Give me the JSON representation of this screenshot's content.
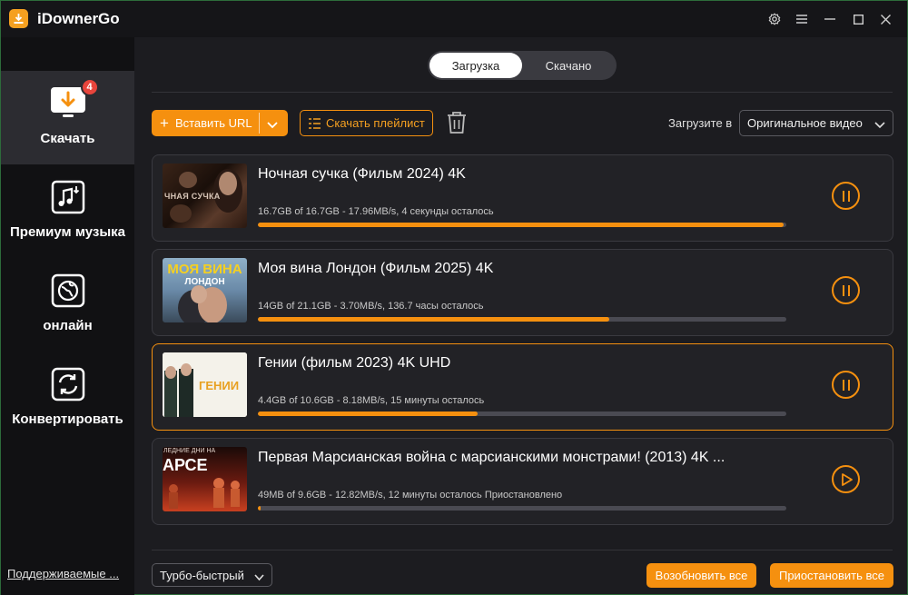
{
  "app": {
    "title": "iDownerGo"
  },
  "sidebar": {
    "items": [
      {
        "label": "Скачать",
        "badge": "4",
        "icon": "download-monitor-icon"
      },
      {
        "label": "Премиум музыка",
        "icon": "music-file-icon"
      },
      {
        "label": "онлайн",
        "icon": "globe-icon"
      },
      {
        "label": "Конвертировать",
        "icon": "convert-icon"
      }
    ],
    "supported_link": "Поддерживаемые ..."
  },
  "tabs": [
    {
      "label": "Загрузка",
      "active": true
    },
    {
      "label": "Скачано",
      "active": false
    }
  ],
  "toolbar": {
    "paste_url": "Вставить URL",
    "download_playlist": "Скачать плейлист",
    "download_to_label": "Загрузите в",
    "quality_value": "Оригинальное видео"
  },
  "downloads": [
    {
      "title": "Ночная сучка (Фильм 2024) 4K",
      "status": "16.7GB of 16.7GB -   17.96MB/s, 4 секунды осталось",
      "progress": 0.995,
      "state": "downloading",
      "thumb_text": "ЧНАЯ СУЧКА",
      "highlight": false
    },
    {
      "title": "Моя вина Лондон (Фильм 2025) 4K",
      "status": "14GB of 21.1GB -   3.70MB/s, 136.7 часы осталось",
      "progress": 0.665,
      "state": "downloading",
      "thumb_text": "МОЯ ВИНА",
      "thumb_subtext": "ЛОНДОН",
      "highlight": false
    },
    {
      "title": "Гении (фильм 2023) 4K UHD",
      "status": "4.4GB of 10.6GB -   8.18MB/s, 15 минуты осталось",
      "progress": 0.415,
      "state": "downloading",
      "thumb_text": "ГЕНИИ",
      "highlight": true
    },
    {
      "title": "Первая Марсианская война с марсианскими монстрами! (2013) 4K ...",
      "status": "49MB of 9.6GB -   12.82MB/s, 12 минуты осталось Приостановлено",
      "progress": 0.005,
      "state": "paused",
      "thumb_text": "АРСЕ",
      "thumb_subtext": "ЛЕДНИЕ ДНИ НА",
      "highlight": false
    }
  ],
  "footer": {
    "speed_mode": "Турбо-быстрый",
    "resume_all": "Возобновить все",
    "pause_all": "Приостановить все"
  },
  "colors": {
    "accent": "#f5900f",
    "background": "#1c1c20",
    "sidebar": "#111113",
    "card": "#222226"
  }
}
